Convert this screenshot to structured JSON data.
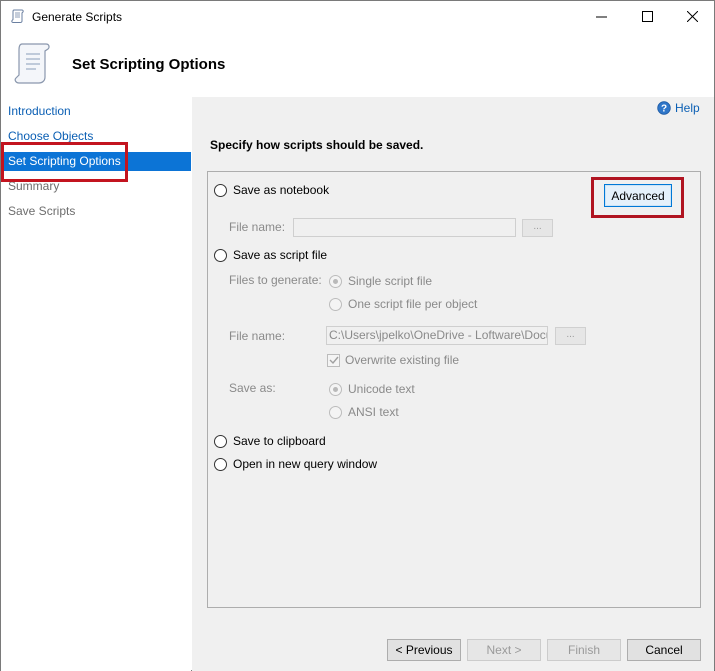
{
  "window": {
    "title": "Generate Scripts",
    "page_heading": "Set Scripting Options"
  },
  "sidebar": {
    "items": [
      {
        "label": "Introduction",
        "state": "link"
      },
      {
        "label": "Choose Objects",
        "state": "link"
      },
      {
        "label": "Set Scripting Options",
        "state": "selected"
      },
      {
        "label": "Summary",
        "state": "disabled"
      },
      {
        "label": "Save Scripts",
        "state": "disabled"
      }
    ]
  },
  "main": {
    "help_label": "Help",
    "instruction": "Specify how scripts should be saved.",
    "options": {
      "save_as_notebook": "Save as notebook",
      "notebook_file_name_label": "File name:",
      "notebook_file_name_value": "",
      "browse_label": "...",
      "advanced_button": "Advanced",
      "save_as_script_file": "Save as script file",
      "files_to_generate_label": "Files to generate:",
      "single_script_file": "Single script file",
      "one_script_per_object": "One script file per object",
      "script_file_name_label": "File name:",
      "script_file_name_value": "C:\\Users\\jpelko\\OneDrive - Loftware\\Documents",
      "overwrite_existing": "Overwrite existing file",
      "save_as_label": "Save as:",
      "unicode_text": "Unicode text",
      "ansi_text": "ANSI text",
      "save_to_clipboard": "Save to clipboard",
      "open_in_new_query_window": "Open in new query window"
    }
  },
  "footer": {
    "previous": "< Previous",
    "next": "Next >",
    "finish": "Finish",
    "cancel": "Cancel"
  },
  "colors": {
    "accent": "#0c74d6",
    "highlight_box": "#c3141f"
  }
}
